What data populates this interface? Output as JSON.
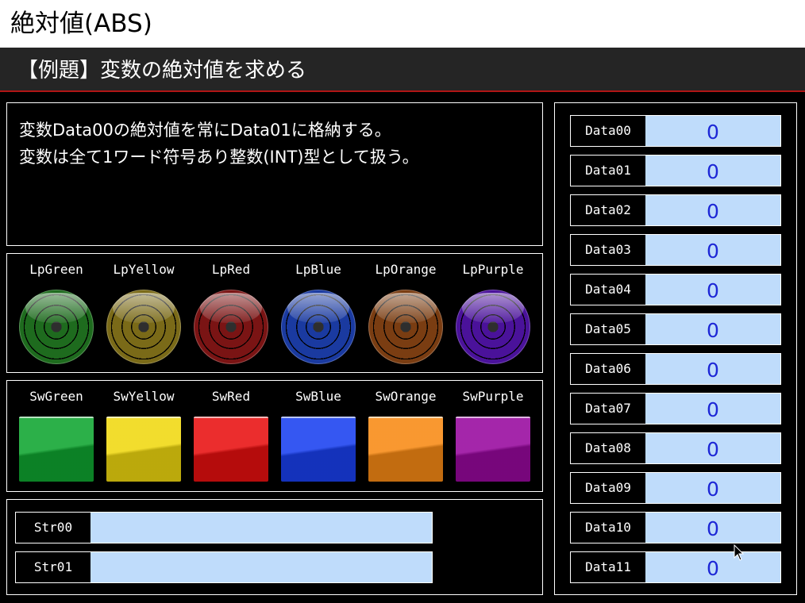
{
  "window_title": "絶対値(ABS)",
  "example_title": "【例題】変数の絶対値を求める",
  "description": {
    "line1": "変数Data00の絶対値を常にData01に格納する。",
    "line2": "変数は全て1ワード符号あり整数(INT)型として扱う。"
  },
  "lamps": [
    {
      "label": "LpGreen",
      "color": "#1e6b1e"
    },
    {
      "label": "LpYellow",
      "color": "#7a6a18"
    },
    {
      "label": "LpRed",
      "color": "#7a1414"
    },
    {
      "label": "LpBlue",
      "color": "#1a3aa0"
    },
    {
      "label": "LpOrange",
      "color": "#7a3d12"
    },
    {
      "label": "LpPurple",
      "color": "#4a129a"
    }
  ],
  "switches": [
    {
      "label": "SwGreen",
      "color": "#0fa530"
    },
    {
      "label": "SwYellow",
      "color": "#f0d810"
    },
    {
      "label": "SwRed",
      "color": "#e81010"
    },
    {
      "label": "SwBlue",
      "color": "#1940f0"
    },
    {
      "label": "SwOrange",
      "color": "#f88a14"
    },
    {
      "label": "SwPurple",
      "color": "#98089e"
    }
  ],
  "strings": [
    {
      "label": "Str00",
      "value": ""
    },
    {
      "label": "Str01",
      "value": ""
    }
  ],
  "data_vars": [
    {
      "label": "Data00",
      "value": "0"
    },
    {
      "label": "Data01",
      "value": "0"
    },
    {
      "label": "Data02",
      "value": "0"
    },
    {
      "label": "Data03",
      "value": "0"
    },
    {
      "label": "Data04",
      "value": "0"
    },
    {
      "label": "Data05",
      "value": "0"
    },
    {
      "label": "Data06",
      "value": "0"
    },
    {
      "label": "Data07",
      "value": "0"
    },
    {
      "label": "Data08",
      "value": "0"
    },
    {
      "label": "Data09",
      "value": "0"
    },
    {
      "label": "Data10",
      "value": "0"
    },
    {
      "label": "Data11",
      "value": "0"
    }
  ],
  "icons": {
    "cursor": "mouse-pointer-icon"
  }
}
